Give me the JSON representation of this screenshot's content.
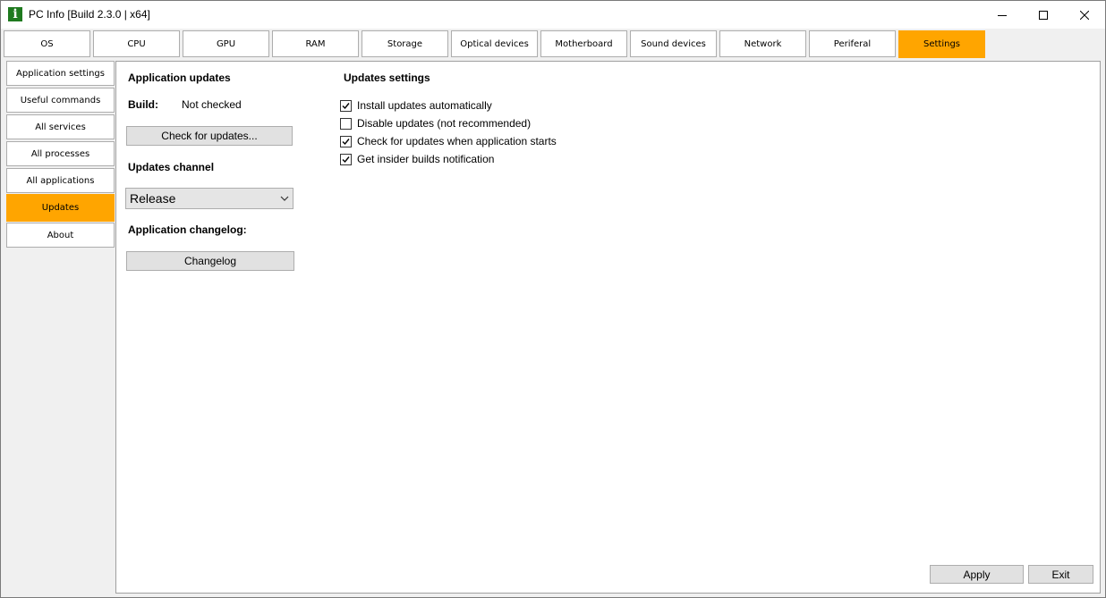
{
  "window": {
    "title": "PC Info [Build 2.3.0 | x64]",
    "icon_letter": "i"
  },
  "tabs": [
    {
      "label": "OS",
      "active": false
    },
    {
      "label": "CPU",
      "active": false
    },
    {
      "label": "GPU",
      "active": false
    },
    {
      "label": "RAM",
      "active": false
    },
    {
      "label": "Storage",
      "active": false
    },
    {
      "label": "Optical devices",
      "active": false
    },
    {
      "label": "Motherboard",
      "active": false
    },
    {
      "label": "Sound devices",
      "active": false
    },
    {
      "label": "Network",
      "active": false
    },
    {
      "label": "Periferal",
      "active": false
    },
    {
      "label": "Settings",
      "active": true
    }
  ],
  "nav": [
    {
      "label": "Application settings",
      "active": false
    },
    {
      "label": "Useful commands",
      "active": false
    },
    {
      "label": "All services",
      "active": false
    },
    {
      "label": "All processes",
      "active": false
    },
    {
      "label": "All applications",
      "active": false
    },
    {
      "label": "Updates",
      "active": true
    },
    {
      "label": "About",
      "active": false
    }
  ],
  "updates": {
    "heading": "Application updates",
    "build_label": "Build:",
    "build_value": "Not checked",
    "check_button": "Check for updates...",
    "channel_heading": "Updates channel",
    "channel_selected": "Release",
    "changelog_heading": "Application changelog:",
    "changelog_button": "Changelog"
  },
  "settings": {
    "heading": "Updates settings",
    "options": [
      {
        "label": "Install updates automatically",
        "checked": true
      },
      {
        "label": "Disable updates (not recommended)",
        "checked": false
      },
      {
        "label": "Check for updates when application starts",
        "checked": true
      },
      {
        "label": "Get insider builds notification",
        "checked": true
      }
    ]
  },
  "footer": {
    "apply_label": "Apply",
    "exit_label": "Exit"
  },
  "colors": {
    "accent": "#ffa500",
    "icon_green": "#1f7a1f"
  },
  "icons": {
    "minimize": "minimize-icon",
    "maximize": "maximize-icon",
    "close": "close-icon",
    "dropdown": "chevron-down-icon",
    "check": "checkmark-icon"
  }
}
